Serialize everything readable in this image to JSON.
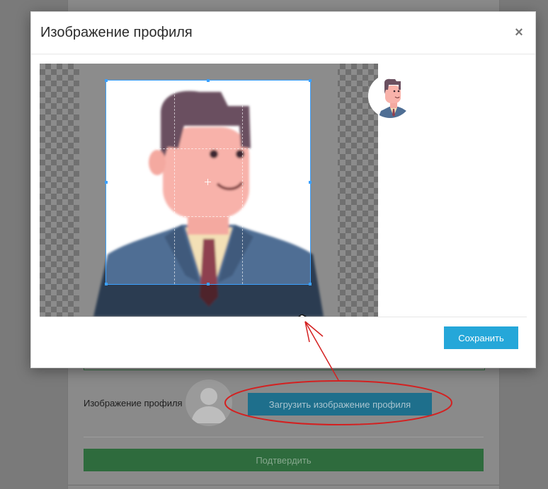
{
  "modal": {
    "title": "Изображение профиля",
    "close_label": "×",
    "save_label": "Сохранить"
  },
  "form": {
    "profile_image_label": "Изображение профиля",
    "upload_label": "Загрузить изображение профиля",
    "confirm_label": "Подтвердить"
  },
  "icons": {
    "close": "close-icon",
    "cursor": "grab-hand-icon",
    "avatar_placeholder": "user-silhouette-icon"
  },
  "colors": {
    "save_button": "#25a7d9",
    "upload_button": "#1e6f8c",
    "confirm_button": "#2e6b3d",
    "crop_outline": "#3aa0ff",
    "annotation": "#d42020"
  }
}
